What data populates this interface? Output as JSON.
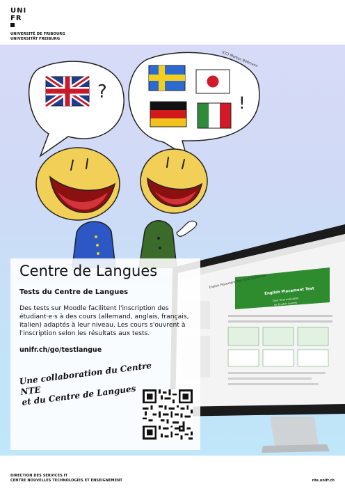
{
  "header": {
    "logo_line1": "UNI",
    "logo_line2": "FR",
    "university_fr": "UNIVERSITÉ DE FRIBOURG",
    "university_de": "UNIVERSITÄT FREIBURG"
  },
  "artwork": {
    "credit": "(CC) Markus Böllmann",
    "left_bubble_mark": "?",
    "right_bubble_mark": "!",
    "flags": [
      "uk-flag",
      "sweden-flag",
      "japan-flag",
      "germany-flag",
      "italy-flag"
    ]
  },
  "panel": {
    "title": "Centre de Langues",
    "subtitle": "Tests du Centre de Langues",
    "body": "Des tests sur Moodle facilitent l'inscription des étudiant·e·s à des cours (allemand, anglais, français, italien) adaptés à leur niveau. Les cours s'ouvrent à l'inscription selon les résultats aux tests.",
    "link": "unifr.ch/go/testlangue",
    "collab_line1": "Une collaboration du Centre NTE",
    "collab_line2": "et du Centre de Langues"
  },
  "monitor": {
    "page_heading": "English Placement Test 2016 September",
    "banner_title": "English Placement Test",
    "banner_line1": "Dear level evaluation",
    "banner_line2": "for English courses"
  },
  "footer": {
    "line1": "DIRECTION DES SERVICES IT",
    "line2": "CENTRE NOUVELLES TECHNOLOGIES ET ENSEIGNEMENT",
    "url": "nte.unifr.ch"
  },
  "colors": {
    "background_top": "#d7dbf7",
    "background_bottom": "#bfe6f9",
    "face": "#f2cf57",
    "mouth": "#8b1010",
    "banner_green": "#2e8b2e"
  }
}
